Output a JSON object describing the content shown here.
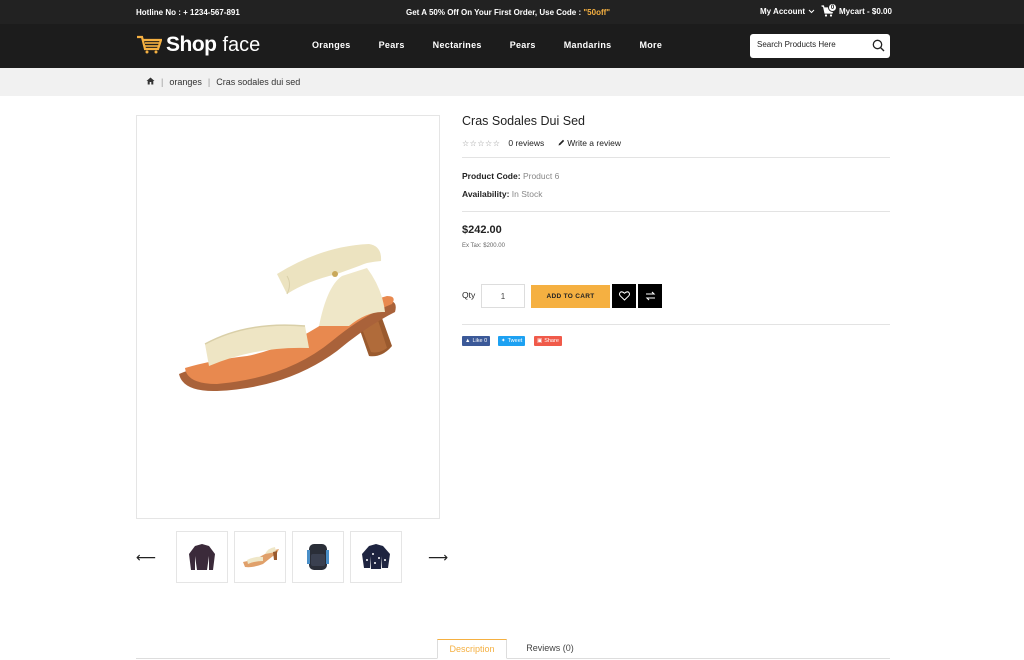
{
  "topbar": {
    "hotline": "Hotline No : + 1234-567-891",
    "promo_text": "Get A 50% Off On Your First Order, Use Code : ",
    "promo_code": "\"50off\"",
    "account": "My Account",
    "cart_count": "0",
    "cart_label": "Mycart - $0.00"
  },
  "header": {
    "logo_shop": "Shop",
    "logo_face": "face",
    "nav": [
      "Oranges",
      "Pears",
      "Nectarines",
      "Pears",
      "Mandarins",
      "More"
    ],
    "search_placeholder": "Search Products Here"
  },
  "breadcrumb": {
    "items": [
      "oranges",
      "Cras sodales dui sed"
    ]
  },
  "product": {
    "title": "Cras Sodales Dui Sed",
    "stars": "☆☆☆☆☆",
    "reviews": "0 reviews",
    "write_review": "Write a review",
    "code_label": "Product Code:",
    "code_value": "Product 6",
    "availability_label": "Availability:",
    "availability_value": "In Stock",
    "price": "$242.00",
    "ex_tax": "Ex Tax: $200.00",
    "qty_label": "Qty",
    "qty_value": "1",
    "add_to_cart": "ADD TO CART"
  },
  "social": {
    "like": "Like 0",
    "tweet": "Tweet",
    "share": "Share"
  },
  "tabs": [
    "Description",
    "Reviews (0)"
  ],
  "colors": {
    "accent": "#f5b041",
    "header_bg": "#1c1c1c",
    "facebook": "#3b5998",
    "twitter": "#1da1f2",
    "share": "#f05a4a"
  }
}
